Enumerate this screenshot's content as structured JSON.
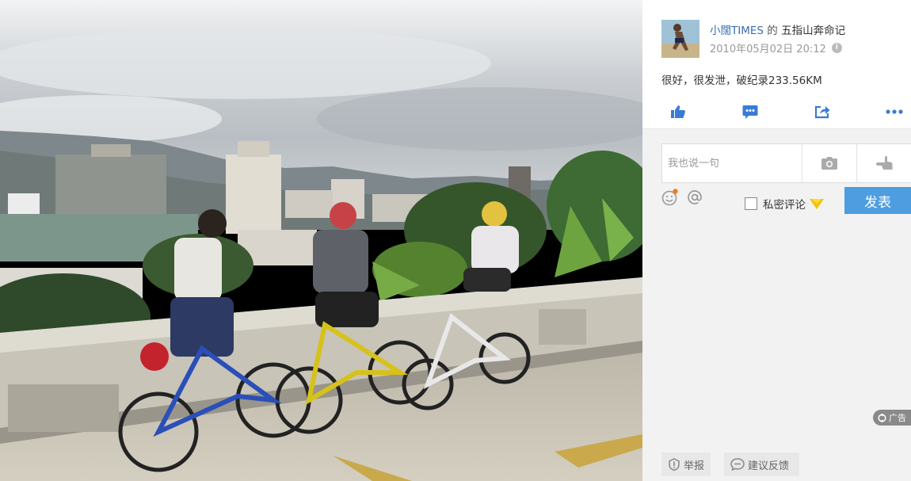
{
  "post": {
    "author": "小闊TIMES",
    "of_text": "的",
    "album": "五指山奔命记",
    "datetime": "2010年05月02日 20:12",
    "info_icon": "i",
    "description": "很好，很发泄，破纪录233.56KM"
  },
  "actions": {
    "icons": [
      "thumbs-up-icon",
      "comment-icon",
      "share-icon",
      "more-icon"
    ],
    "color": "#3a7bd5"
  },
  "comment": {
    "placeholder": "我也说一句",
    "private_label": "私密评论",
    "submit_label": "发表"
  },
  "sidebar": {
    "ad_label": "广告"
  },
  "footer": {
    "report_label": "举报",
    "feedback_label": "建议反馈"
  },
  "colors": {
    "accent": "#4d9de0",
    "link": "#3a6fb0",
    "panel_bg": "#f2f2f2",
    "vip_diamond": "#f5c400"
  }
}
